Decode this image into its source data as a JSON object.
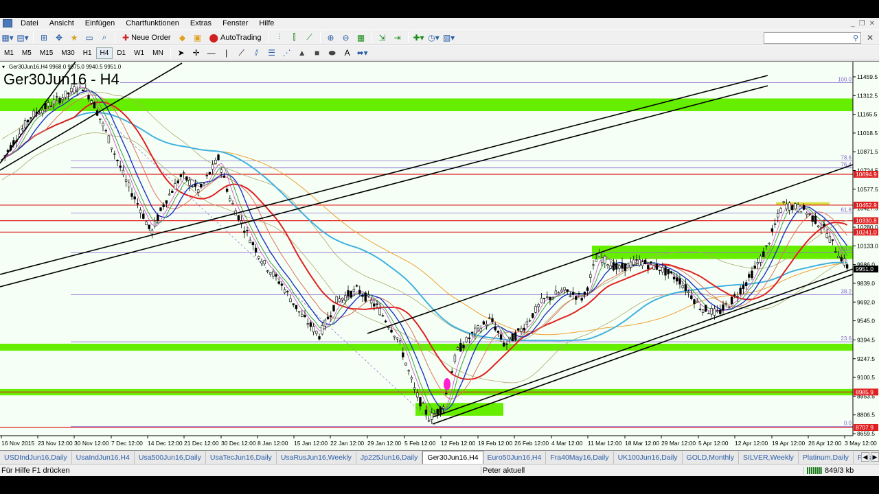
{
  "menu": [
    "Datei",
    "Ansicht",
    "Einfügen",
    "Chartfunktionen",
    "Extras",
    "Fenster",
    "Hilfe"
  ],
  "toolbar": {
    "new_order": "Neue Order",
    "auto_trading": "AutoTrading"
  },
  "timeframes": [
    "M1",
    "M5",
    "M15",
    "M30",
    "H1",
    "H4",
    "D1",
    "W1",
    "MN"
  ],
  "active_timeframe": "H4",
  "chart": {
    "info": "Ger30Jun16,H4  9968.0 9975.0 9940.5 9951.0",
    "title": "Ger30Jun16 - H4",
    "price_labels": [
      "11459.5",
      "11312.5",
      "11165.5",
      "11018.5",
      "10871.5",
      "10724.5",
      "10577.5",
      "10427.5",
      "10280.0",
      "10133.0",
      "9986.0",
      "9839.0",
      "9692.0",
      "9545.0",
      "9394.5",
      "9247.5",
      "9100.5",
      "8953.5",
      "8806.5",
      "8659.5"
    ],
    "marked_prices": [
      {
        "value": "10694.9",
        "color": "#e02020"
      },
      {
        "value": "10452.9",
        "color": "#e02020"
      },
      {
        "value": "10330.8",
        "color": "#e02020"
      },
      {
        "value": "10241.0",
        "color": "#e02020"
      },
      {
        "value": "9951.0",
        "color": "#000000"
      },
      {
        "value": "8985.9",
        "color": "#e02020"
      },
      {
        "value": "8707.9",
        "color": "#e02020"
      }
    ],
    "fib_levels": [
      "100.0",
      "78.6",
      "76.4",
      "61.8",
      "50.0",
      "38.2",
      "23.6",
      "0.0"
    ],
    "date_labels": [
      "16 Nov 2015",
      "23 Nov 12:00",
      "30 Nov 12:00",
      "7 Dec 12:00",
      "14 Dec 12:00",
      "21 Dec 12:00",
      "30 Dec 12:00",
      "8 Jan 12:00",
      "15 Jan 12:00",
      "22 Jan 12:00",
      "29 Jan 12:00",
      "5 Feb 12:00",
      "12 Feb 12:00",
      "19 Feb 12:00",
      "26 Feb 12:00",
      "4 Mar 12:00",
      "11 Mar 12:00",
      "18 Mar 12:00",
      "29 Mar 12:00",
      "5 Apr 12:00",
      "12 Apr 12:00",
      "19 Apr 12:00",
      "26 Apr 12:00",
      "3 May 12:00"
    ],
    "colors": {
      "zone": "#66ee00",
      "hline": "#e02020",
      "fib": "#8a6ad0",
      "ma_red": "#e02020",
      "ma_blue": "#2030c0",
      "ma_cyan": "#40b0e0",
      "ma_orange": "#f0a030",
      "bollinger": "#b0a870"
    }
  },
  "tabs": [
    "USDIndJun16,Daily",
    "UsaIndJun16,H4",
    "Usa500Jun16,Daily",
    "UsaTecJun16,Daily",
    "UsaRusJun16,Weekly",
    "Jp225Jun16,Daily",
    "Ger30Jun16,H4",
    "Euro50Jun16,H4",
    "Fra40May16,Daily",
    "UK100Jun16,Daily",
    "GOLD,Monthly",
    "SILVER,Weekly",
    "Platinum,Daily",
    "Palladiu"
  ],
  "active_tab": "Ger30Jun16,H4",
  "status": {
    "help": "Für Hilfe F1 drücken",
    "profile": "Peter aktuell",
    "traffic": "849/3 kb"
  }
}
